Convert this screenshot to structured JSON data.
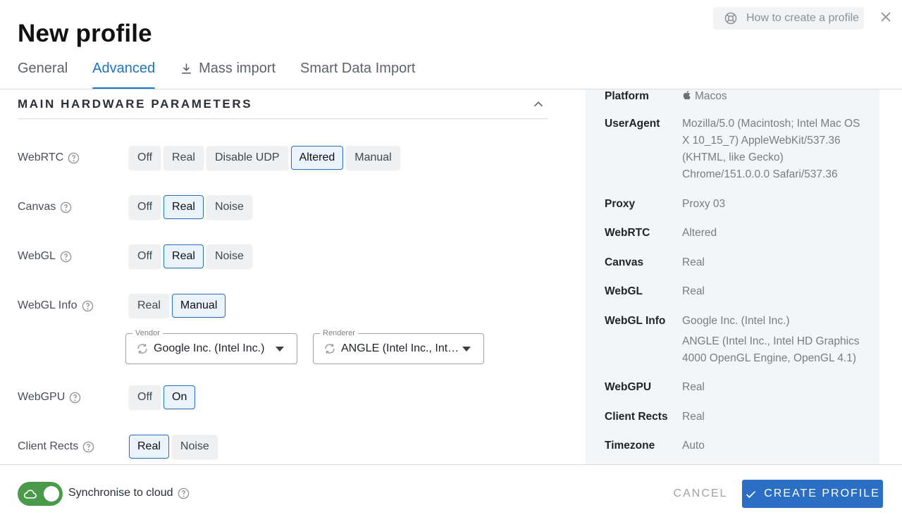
{
  "header": {
    "title": "New profile",
    "help_label": "How to create a profile",
    "help_icon": "lifebuoy-icon",
    "close_icon": "close-icon"
  },
  "tabs": [
    {
      "label": "General",
      "active": false
    },
    {
      "label": "Advanced",
      "active": true
    },
    {
      "label": "Mass import",
      "active": false,
      "icon": "download-icon"
    },
    {
      "label": "Smart Data Import",
      "active": false
    }
  ],
  "section": {
    "title": "MAIN HARDWARE PARAMETERS",
    "icon": "chevron-up-icon"
  },
  "settings": {
    "webrtc": {
      "label": "WebRTC",
      "options": [
        "Off",
        "Real",
        "Disable UDP",
        "Altered",
        "Manual"
      ],
      "selected": "Altered"
    },
    "canvas": {
      "label": "Canvas",
      "options": [
        "Off",
        "Real",
        "Noise"
      ],
      "selected": "Real"
    },
    "webgl": {
      "label": "WebGL",
      "options": [
        "Off",
        "Real",
        "Noise"
      ],
      "selected": "Real"
    },
    "webgl_info": {
      "label": "WebGL Info",
      "options": [
        "Real",
        "Manual"
      ],
      "selected": "Manual"
    },
    "vendor": {
      "legend": "Vendor",
      "value": "Google Inc. (Intel Inc.)"
    },
    "renderer": {
      "legend": "Renderer",
      "value": "ANGLE (Intel Inc., Inte..."
    },
    "webgpu": {
      "label": "WebGPU",
      "options": [
        "Off",
        "On"
      ],
      "selected": "On"
    },
    "client_rects": {
      "label": "Client Rects",
      "options": [
        "Real",
        "Noise"
      ],
      "selected": "Real"
    }
  },
  "summary": {
    "platform_key": "Platform",
    "platform_val": "Macos",
    "platform_icon": "apple-icon",
    "useragent_key": "UserAgent",
    "useragent_val": "Mozilla/5.0 (Macintosh; Intel Mac OS X 10_15_7) AppleWebKit/537.36 (KHTML, like Gecko) Chrome/151.0.0.0 Safari/537.36",
    "proxy_key": "Proxy",
    "proxy_val": "Proxy 03",
    "webrtc_key": "WebRTC",
    "webrtc_val": "Altered",
    "canvas_key": "Canvas",
    "canvas_val": "Real",
    "webgl_key": "WebGL",
    "webgl_val": "Real",
    "webglinfo_key": "WebGL Info",
    "webglinfo_val1": "Google Inc. (Intel Inc.)",
    "webglinfo_val2": "ANGLE (Intel Inc., Intel HD Graphics 4000 OpenGL Engine, OpenGL 4.1)",
    "webgpu_key": "WebGPU",
    "webgpu_val": "Real",
    "clientrects_key": "Client Rects",
    "clientrects_val": "Real",
    "timezone_key": "Timezone",
    "timezone_val": "Auto"
  },
  "footer": {
    "sync_label": "Synchronise to cloud",
    "sync_on": true,
    "cancel_label": "CANCEL",
    "create_label": "CREATE PROFILE",
    "accent": "#2b6fc4",
    "toggle_color": "#4a9a4c"
  }
}
